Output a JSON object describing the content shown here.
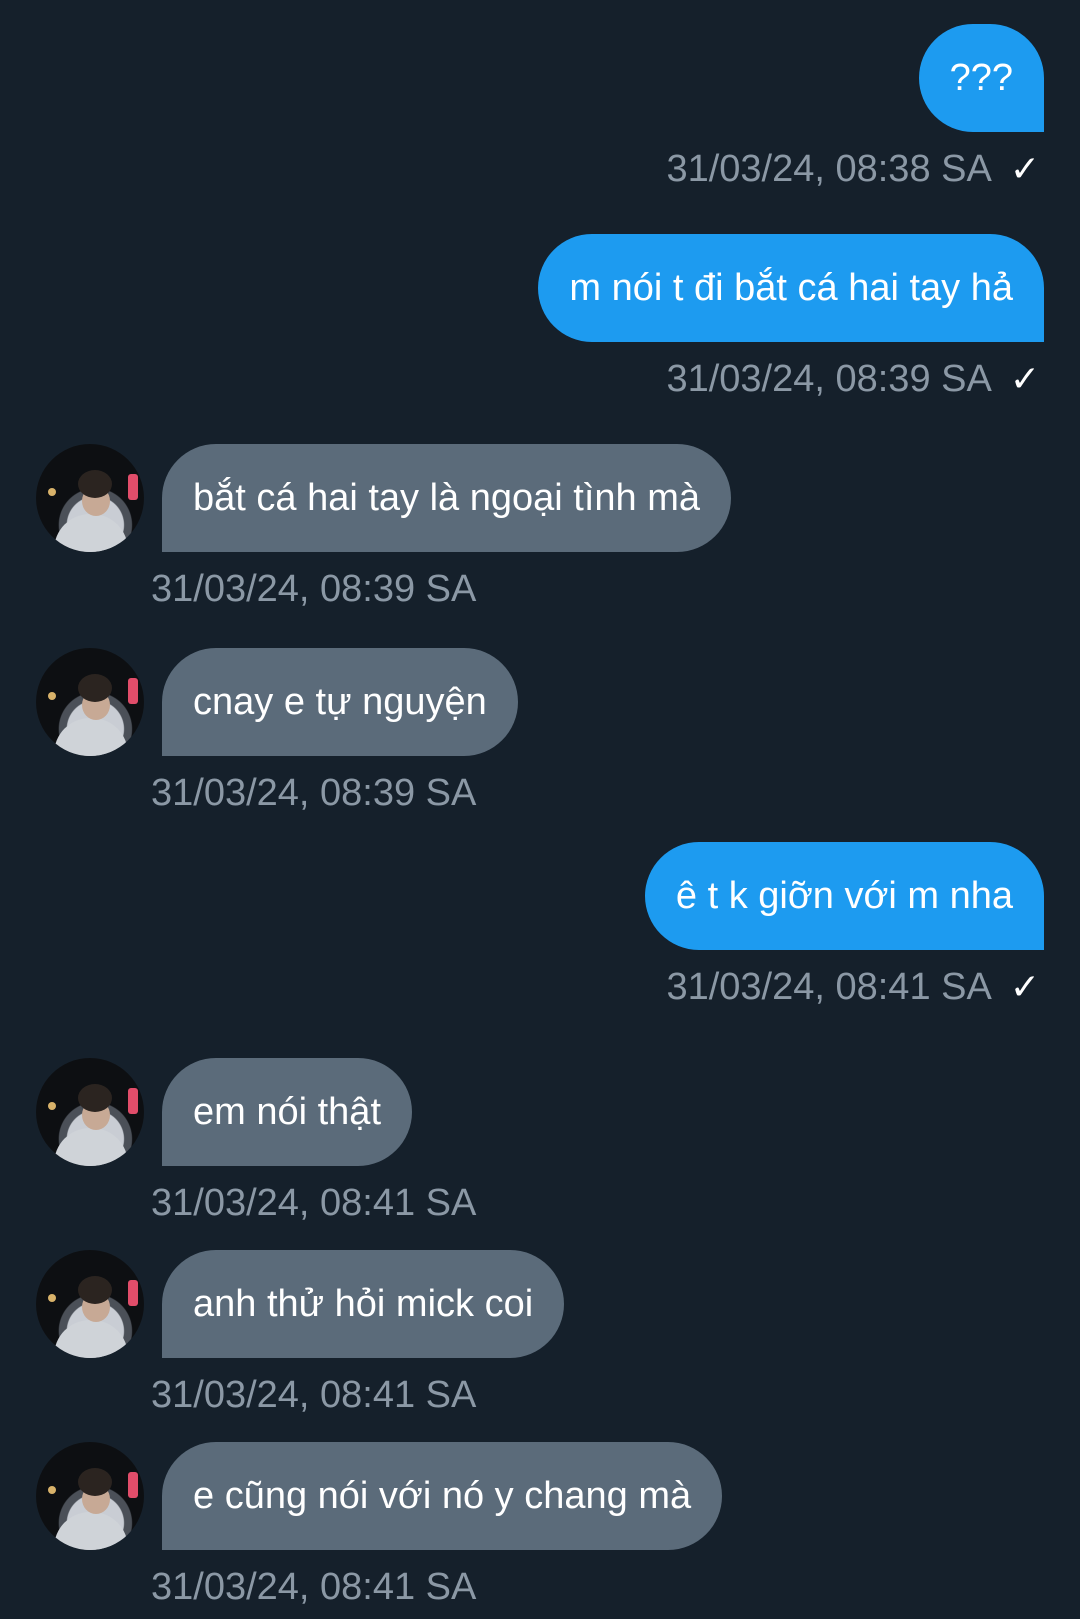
{
  "conversation": {
    "messages": [
      {
        "text": "???",
        "time": "31/03/24, 08:38 SA",
        "check": "✓"
      },
      {
        "text": "m nói t đi bắt cá hai tay hả",
        "time": "31/03/24, 08:39 SA",
        "check": "✓"
      },
      {
        "text": "bắt cá hai tay là ngoại tình mà",
        "time": "31/03/24, 08:39 SA"
      },
      {
        "text": "cnay e tự nguyện",
        "time": "31/03/24, 08:39 SA"
      },
      {
        "text": "ê t k giỡn với m nha",
        "time": "31/03/24, 08:41 SA",
        "check": "✓"
      },
      {
        "text": "em nói thật",
        "time": "31/03/24, 08:41 SA"
      },
      {
        "text": "anh thử hỏi mick coi",
        "time": "31/03/24, 08:41 SA"
      },
      {
        "text": "e cũng nói với nó y chang mà",
        "time": "31/03/24, 08:41 SA"
      }
    ]
  },
  "colors": {
    "background": "#15202b",
    "sent_bubble": "#1d9bf0",
    "received_bubble": "#5b6b7a",
    "timestamp": "#8b98a5"
  },
  "icons": {
    "read_receipt": "checkmark-icon",
    "avatar": "avatar-photo"
  }
}
